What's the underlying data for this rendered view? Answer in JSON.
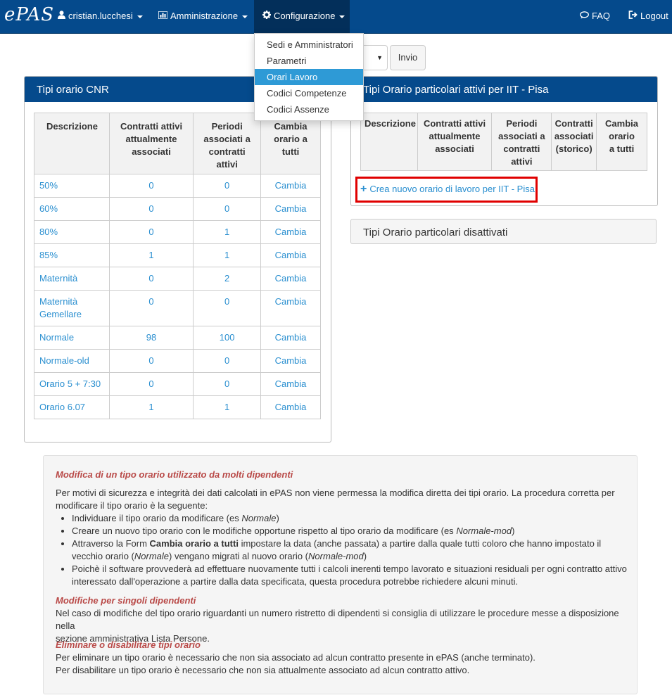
{
  "nav": {
    "brand": "ePAS",
    "user": "cristian.lucchesi",
    "admin": "Amministrazione",
    "config": "Configurazione",
    "faq": "FAQ",
    "logout": "Logout"
  },
  "dropdown": {
    "items": [
      "Sedi e Amministratori",
      "Parametri",
      "Orari Lavoro",
      "Codici Competenze",
      "Codici Assenze"
    ]
  },
  "form": {
    "submit": "Invio"
  },
  "cnr_panel": {
    "title": "Tipi orario CNR",
    "headers": [
      "Descrizione",
      "Contratti attivi attualmente associati",
      "Periodi associati a contratti attivi",
      "Cambia orario a tutti"
    ],
    "rows": [
      {
        "name": "50%",
        "contracts": "0",
        "periods": "0",
        "action": "Cambia"
      },
      {
        "name": "60%",
        "contracts": "0",
        "periods": "0",
        "action": "Cambia"
      },
      {
        "name": "80%",
        "contracts": "0",
        "periods": "1",
        "action": "Cambia"
      },
      {
        "name": "85%",
        "contracts": "1",
        "periods": "1",
        "action": "Cambia"
      },
      {
        "name": "Maternità",
        "contracts": "0",
        "periods": "2",
        "action": "Cambia"
      },
      {
        "name": "Maternità Gemellare",
        "contracts": "0",
        "periods": "0",
        "action": "Cambia"
      },
      {
        "name": "Normale",
        "contracts": "98",
        "periods": "100",
        "action": "Cambia"
      },
      {
        "name": "Normale-old",
        "contracts": "0",
        "periods": "0",
        "action": "Cambia"
      },
      {
        "name": "Orario 5 + 7:30",
        "contracts": "0",
        "periods": "0",
        "action": "Cambia"
      },
      {
        "name": "Orario 6.07",
        "contracts": "1",
        "periods": "1",
        "action": "Cambia"
      }
    ]
  },
  "iit_panel": {
    "title": "Tipi Orario particolari attivi per IIT - Pisa",
    "headers": [
      "Descrizione",
      "Contratti attivi attualmente associati",
      "Periodi associati a contratti attivi",
      "Contratti associati (storico)",
      "Cambia orario a tutti"
    ],
    "create_link": "Crea nuovo orario di lavoro per IIT - Pisa"
  },
  "disabled_panel": {
    "title": "Tipi Orario particolari disattivati"
  },
  "info": {
    "h1": "Modifica di un tipo orario utilizzato da molti dipendenti",
    "p1a": "Per motivi di sicurezza e integrità dei dati calcolati in ePAS non viene permessa la modifica diretta dei tipi orario. La procedura corretta per",
    "p1b": "modificare il tipo orario è la seguente:",
    "b1a": "Individuare il tipo orario da modificare (es ",
    "b1b": "Normale",
    "b1c": ")",
    "b2a": "Creare un nuovo tipo orario con le modifiche opportune rispetto al tipo orario da modificare (es ",
    "b2b": "Normale-mod",
    "b2c": ")",
    "b3a": "Attraverso la Form ",
    "b3b": "Cambia orario a tutti",
    "b3c": " impostare la data (anche passata) a partire dalla quale tutti coloro che hanno impostato il",
    "b3d": "vecchio orario (",
    "b3e": "Normale",
    "b3f": ") vengano migrati al nuovo orario (",
    "b3g": "Normale-mod",
    "b3h": ")",
    "b4a": "Poichè il software provvederà ad effettuare nuovamente tutti i calcoli inerenti tempo lavorato e situazioni residuali per ogni contratto attivo",
    "b4b": "interessato dall'operazione a partire dalla data specificata, questa procedura potrebbe richiedere alcuni minuti.",
    "h2": "Modifiche per singoli dipendenti",
    "p2a": "Nel caso di modifiche del tipo orario riguardanti un numero ristretto di dipendenti si consiglia di utilizzare le procedure messe a disposizione nella",
    "p2b": "sezione amministrativa Lista Persone.",
    "h3": "Eliminare o disabilitare tipi orario",
    "p3a": "Per eliminare un tipo orario è necessario che non sia associato ad alcun contratto presente in ePAS (anche terminato).",
    "p3b": "Per disabilitare un tipo orario è necessario che non sia attualmente associato ad alcun contratto attivo."
  }
}
